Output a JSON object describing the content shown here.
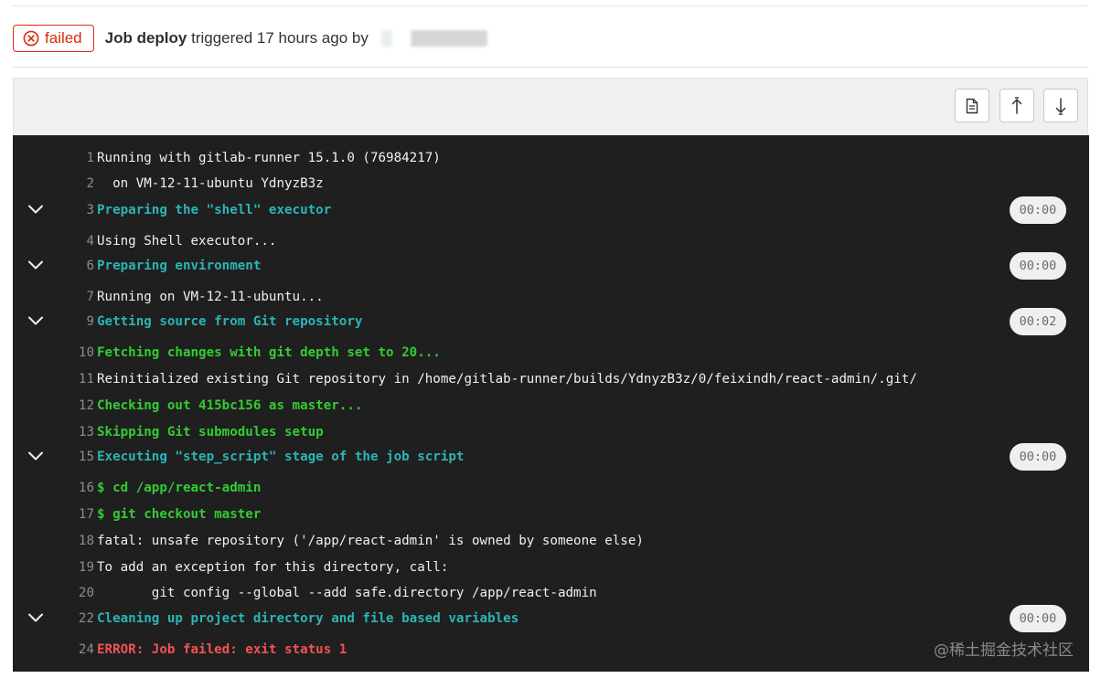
{
  "header": {
    "status": "failed",
    "job_name": "Job deploy",
    "triggered_text": "triggered 17 hours ago by"
  },
  "toolbar": {
    "buttons": [
      {
        "icon": "raw-document-icon",
        "label": "Show complete raw"
      },
      {
        "icon": "scroll-to-top-icon",
        "label": "Scroll to top"
      },
      {
        "icon": "scroll-to-bottom-icon",
        "label": "Scroll to bottom"
      }
    ]
  },
  "log": {
    "lines": [
      {
        "num": "1",
        "text": "Running with gitlab-runner 15.1.0 (76984217)",
        "style": "plain"
      },
      {
        "num": "2",
        "text": "  on VM-12-11-ubuntu YdnyzB3z",
        "style": "plain"
      },
      {
        "num": "3",
        "text": "Preparing the \"shell\" executor",
        "style": "section",
        "duration": "00:00"
      },
      {
        "num": "4",
        "text": "Using Shell executor...",
        "style": "plain"
      },
      {
        "num": "6",
        "text": "Preparing environment",
        "style": "section",
        "duration": "00:00"
      },
      {
        "num": "7",
        "text": "Running on VM-12-11-ubuntu...",
        "style": "plain"
      },
      {
        "num": "9",
        "text": "Getting source from Git repository",
        "style": "section",
        "duration": "00:02"
      },
      {
        "num": "10",
        "text": "Fetching changes with git depth set to 20...",
        "style": "green"
      },
      {
        "num": "11",
        "text": "Reinitialized existing Git repository in /home/gitlab-runner/builds/YdnyzB3z/0/feixindh/react-admin/.git/",
        "style": "plain"
      },
      {
        "num": "12",
        "text": "Checking out 415bc156 as master...",
        "style": "green"
      },
      {
        "num": "13",
        "text": "Skipping Git submodules setup",
        "style": "green"
      },
      {
        "num": "15",
        "text": "Executing \"step_script\" stage of the job script",
        "style": "section",
        "duration": "00:00"
      },
      {
        "num": "16",
        "text": "$ cd /app/react-admin",
        "style": "green"
      },
      {
        "num": "17",
        "text": "$ git checkout master",
        "style": "green"
      },
      {
        "num": "18",
        "text": "fatal: unsafe repository ('/app/react-admin' is owned by someone else)",
        "style": "plain"
      },
      {
        "num": "19",
        "text": "To add an exception for this directory, call:",
        "style": "plain"
      },
      {
        "num": "20",
        "text": "\tgit config --global --add safe.directory /app/react-admin",
        "style": "plain"
      },
      {
        "num": "22",
        "text": "Cleaning up project directory and file based variables",
        "style": "section",
        "duration": "00:00"
      },
      {
        "num": "24",
        "text": "ERROR: Job failed: exit status 1",
        "style": "error"
      }
    ]
  },
  "watermark": "@稀土掘金技术社区"
}
